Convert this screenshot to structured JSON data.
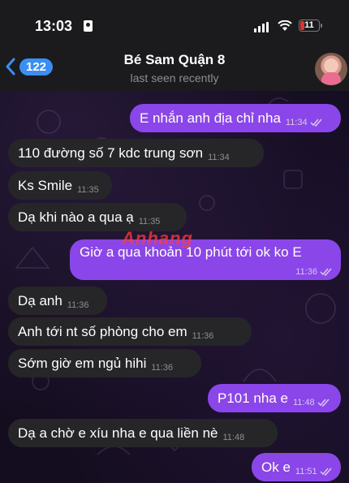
{
  "status_bar": {
    "time": "13:03",
    "battery": "11"
  },
  "header": {
    "back_count": "122",
    "title": "Bé Sam Quận 8",
    "subtitle": "last seen recently"
  },
  "messages": [
    {
      "text": "E nhắn anh địa chỉ nha",
      "time": "11:34",
      "dir": "out"
    },
    {
      "text": "110 đường số 7 kdc trung sơn",
      "time": "11:34",
      "dir": "in"
    },
    {
      "text": "Ks Smile",
      "time": "11:35",
      "dir": "in"
    },
    {
      "text": "Dạ khi nào a qua ạ",
      "time": "11:35",
      "dir": "in"
    },
    {
      "text": "Giờ a qua khoản 10 phút tới ok ko E",
      "time": "11:36",
      "dir": "out"
    },
    {
      "text": "Dạ anh",
      "time": "11:36",
      "dir": "in"
    },
    {
      "text": "Anh tới nt số phòng cho em",
      "time": "11:36",
      "dir": "in"
    },
    {
      "text": "Sớm giờ em ngủ hihi",
      "time": "11:36",
      "dir": "in"
    },
    {
      "text": "P101 nha e",
      "time": "11:48",
      "dir": "out"
    },
    {
      "text": "Dạ a chờ e xíu nha e qua liền nè",
      "time": "11:48",
      "dir": "in"
    },
    {
      "text": "Ok e",
      "time": "11:51",
      "dir": "out"
    }
  ],
  "watermark": "Anhang",
  "colors": {
    "outgoing": "#8a46e8",
    "incoming": "#262628",
    "accent": "#3a8ff5"
  }
}
